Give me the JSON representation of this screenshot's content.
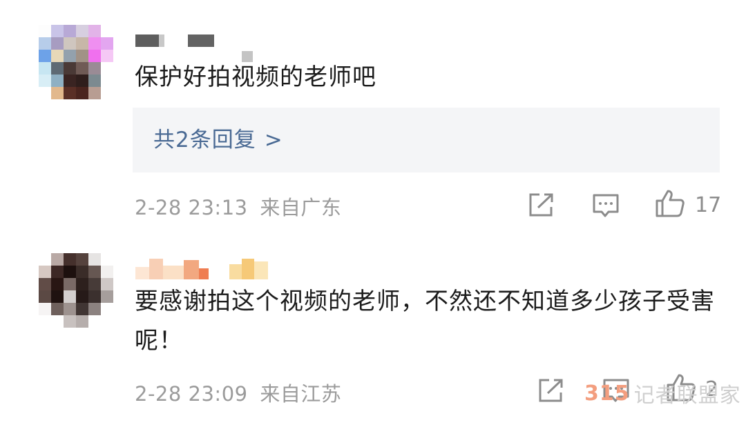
{
  "comments": [
    {
      "text": "保护好拍视频的老师吧",
      "replies_label": "共2条回复",
      "replies_chevron": ">",
      "time": "2-28 23:13",
      "location": "来自广东",
      "like_count": "17"
    },
    {
      "text": "要感谢拍这个视频的老师，不然还不知道多少孩子受害呢！",
      "time": "2-28 23:09",
      "location": "来自江苏",
      "like_count": "2"
    }
  ],
  "watermark": {
    "number": "315",
    "text": "记者联盟家"
  },
  "colors": {
    "link": "#4a6a94",
    "meta": "#9b9b9b",
    "reply_bg": "#f4f5f7",
    "icon": "#8c8c8c"
  }
}
